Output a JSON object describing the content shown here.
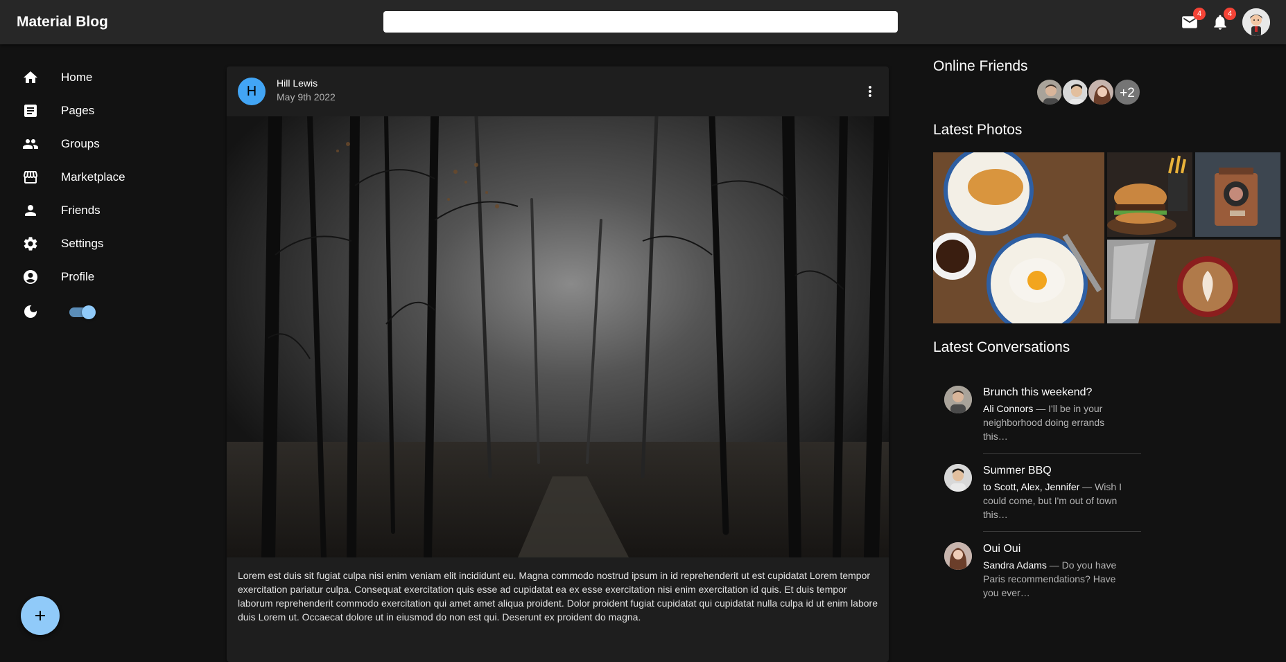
{
  "app": {
    "title": "Material Blog"
  },
  "header": {
    "search_placeholder": "",
    "mail_badge": "4",
    "notifications_badge": "4"
  },
  "sidebar": {
    "items": [
      {
        "label": "Home",
        "icon": "home-icon"
      },
      {
        "label": "Pages",
        "icon": "article-icon"
      },
      {
        "label": "Groups",
        "icon": "groups-icon"
      },
      {
        "label": "Marketplace",
        "icon": "storefront-icon"
      },
      {
        "label": "Friends",
        "icon": "person-icon"
      },
      {
        "label": "Settings",
        "icon": "gear-icon"
      },
      {
        "label": "Profile",
        "icon": "account-circle-icon"
      }
    ],
    "dark_mode": true
  },
  "post": {
    "avatar_letter": "H",
    "author": "Hill Lewis",
    "date": "May 9th 2022",
    "text": "Lorem est duis sit fugiat culpa nisi enim veniam elit incididunt eu. Magna commodo nostrud ipsum in id reprehenderit ut est cupidatat Lorem tempor exercitation pariatur culpa. Consequat exercitation quis esse ad cupidatat ea ex esse exercitation nisi enim exercitation id quis. Et duis tempor laborum reprehenderit commodo exercitation qui amet amet aliqua proident. Dolor proident fugiat cupidatat qui cupidatat nulla culpa id ut enim labore duis Lorem ut. Occaecat dolore ut in eiusmod do non est qui. Deserunt ex proident do magna."
  },
  "right": {
    "online_friends_title": "Online Friends",
    "more_friends": "+2",
    "latest_photos_title": "Latest Photos",
    "latest_conversations_title": "Latest Conversations",
    "conversations": [
      {
        "title": "Brunch this weekend?",
        "who": "Ali Connors",
        "snippet": " — I'll be in your neighborhood doing errands this…"
      },
      {
        "title": "Summer BBQ",
        "who": "to Scott, Alex, Jennifer",
        "snippet": " — Wish I could come, but I'm out of town this…"
      },
      {
        "title": "Oui Oui",
        "who": "Sandra Adams",
        "snippet": " — Do you have Paris recommendations? Have you ever…"
      }
    ]
  },
  "colors": {
    "appbar": "#272727",
    "background": "#121212",
    "card": "#1e1e1e",
    "accent": "#90caf9",
    "avatar_blue": "#42a5f5",
    "badge": "#f44336"
  }
}
